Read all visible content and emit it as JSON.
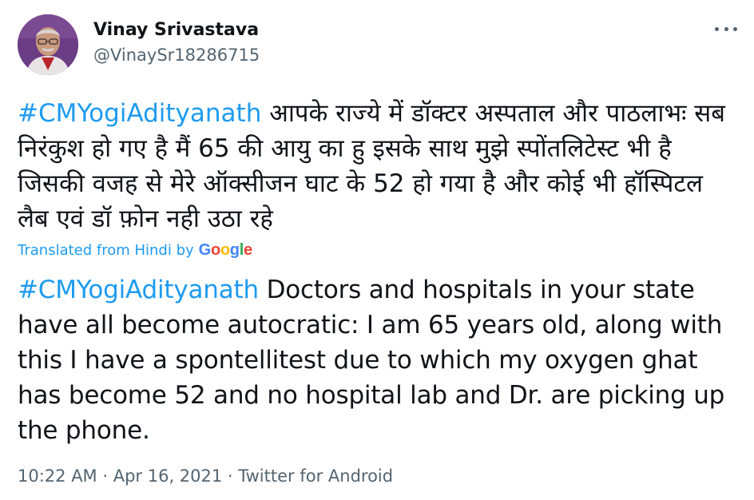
{
  "user": {
    "display_name": "Vinay Srivastava",
    "handle": "@VinaySr18286715"
  },
  "tweet": {
    "hashtag": "#CMYogiAdityanath",
    "original_text": " आपके राज्ये में डॉक्टर अस्पताल और पाठलाभः सब निरंकुश हो गए है मैं 65 की आयु का हु इसके साथ मुझे स्पोंतलिटेस्ट  भी है जिसकी वजह से मेरे ऑक्सीजन घाट के 52 हो गया है और कोई भी हॉस्पिटल लैब एवं डॉ फ़ोन नही उठा रहे",
    "translated_from": "Translated from Hindi by",
    "translation_provider": "Google",
    "translated_hashtag": "#CMYogiAdityanath",
    "translated_text": " Doctors and hospitals in your state have all become autocratic: I am 65 years old, along with this I have a spontellitest due to which my oxygen ghat has become 52 and no hospital lab and Dr. are picking up the phone."
  },
  "meta": {
    "time": "10:22 AM",
    "separator": " · ",
    "date": "Apr 16, 2021",
    "source": "Twitter for Android"
  },
  "icons": {
    "more": "more-horizontal-icon",
    "avatar": "profile-photo"
  },
  "colors": {
    "link": "#1d9bf0",
    "text": "#0f1419",
    "secondary": "#536471"
  }
}
